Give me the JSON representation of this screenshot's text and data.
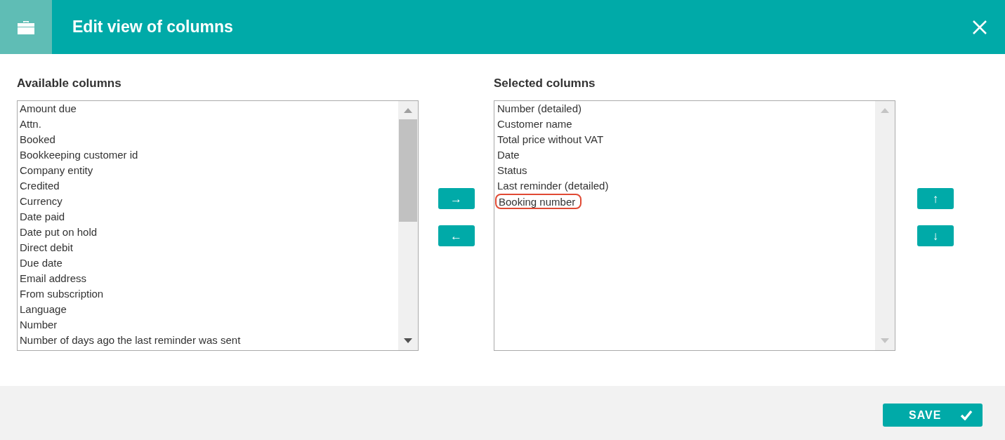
{
  "window": {
    "title": "Edit view of columns"
  },
  "available": {
    "label": "Available columns",
    "items": [
      {
        "text": "Amount due"
      },
      {
        "text": "Attn."
      },
      {
        "text": "Booked"
      },
      {
        "text": "Bookkeeping customer id"
      },
      {
        "text": "Company entity"
      },
      {
        "text": "Credited"
      },
      {
        "text": "Currency"
      },
      {
        "text": "Date paid"
      },
      {
        "text": "Date put on hold"
      },
      {
        "text": "Direct debit"
      },
      {
        "text": "Due date"
      },
      {
        "text": "Email address"
      },
      {
        "text": "From subscription"
      },
      {
        "text": "Language"
      },
      {
        "text": "Number"
      },
      {
        "text": "Number of days ago the last reminder was sent"
      }
    ]
  },
  "transfer_buttons": [
    "→",
    "←"
  ],
  "selected": {
    "label": "Selected columns",
    "items": [
      {
        "text": "Number (detailed)",
        "highlighted": false
      },
      {
        "text": "Customer name",
        "highlighted": false
      },
      {
        "text": "Total price without VAT",
        "highlighted": false
      },
      {
        "text": "Date",
        "highlighted": false
      },
      {
        "text": "Status",
        "highlighted": false
      },
      {
        "text": "Last reminder (detailed)",
        "highlighted": false
      },
      {
        "text": "Booking number",
        "highlighted": true
      }
    ]
  },
  "order_buttons": [
    "↑",
    "↓"
  ],
  "save_button": {
    "label": "SAVE"
  }
}
